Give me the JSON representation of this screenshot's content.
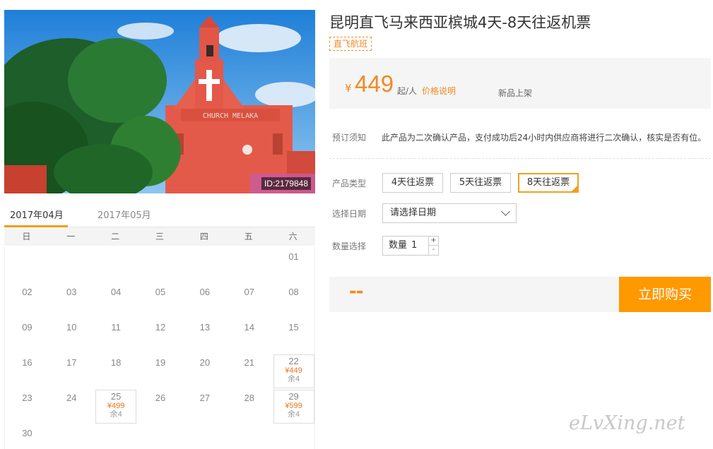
{
  "hero": {
    "id_label": "ID:2179848",
    "sign_text": "CHURCH MELAKA"
  },
  "calendar": {
    "tabs": [
      "2017年04月",
      "2017年05月"
    ],
    "active_tab": 0,
    "weekdays": [
      "日",
      "一",
      "二",
      "三",
      "四",
      "五",
      "六"
    ],
    "days": [
      {
        "day": "01",
        "col": 6,
        "row": 0
      },
      {
        "day": "02",
        "col": 0,
        "row": 1
      },
      {
        "day": "03",
        "col": 1,
        "row": 1
      },
      {
        "day": "04",
        "col": 2,
        "row": 1
      },
      {
        "day": "05",
        "col": 3,
        "row": 1
      },
      {
        "day": "06",
        "col": 4,
        "row": 1
      },
      {
        "day": "07",
        "col": 5,
        "row": 1
      },
      {
        "day": "08",
        "col": 6,
        "row": 1
      },
      {
        "day": "09",
        "col": 0,
        "row": 2
      },
      {
        "day": "10",
        "col": 1,
        "row": 2
      },
      {
        "day": "11",
        "col": 2,
        "row": 2
      },
      {
        "day": "12",
        "col": 3,
        "row": 2
      },
      {
        "day": "13",
        "col": 4,
        "row": 2
      },
      {
        "day": "14",
        "col": 5,
        "row": 2
      },
      {
        "day": "15",
        "col": 6,
        "row": 2
      },
      {
        "day": "16",
        "col": 0,
        "row": 3
      },
      {
        "day": "17",
        "col": 1,
        "row": 3
      },
      {
        "day": "18",
        "col": 2,
        "row": 3
      },
      {
        "day": "19",
        "col": 3,
        "row": 3
      },
      {
        "day": "20",
        "col": 4,
        "row": 3
      },
      {
        "day": "21",
        "col": 5,
        "row": 3
      },
      {
        "day": "22",
        "col": 6,
        "row": 3,
        "price": "¥449",
        "stock": "余4"
      },
      {
        "day": "23",
        "col": 0,
        "row": 4
      },
      {
        "day": "24",
        "col": 1,
        "row": 4
      },
      {
        "day": "25",
        "col": 2,
        "row": 4,
        "price": "¥499",
        "stock": "余4"
      },
      {
        "day": "26",
        "col": 3,
        "row": 4
      },
      {
        "day": "27",
        "col": 4,
        "row": 4
      },
      {
        "day": "28",
        "col": 5,
        "row": 4
      },
      {
        "day": "29",
        "col": 6,
        "row": 4,
        "price": "¥599",
        "stock": "余4"
      },
      {
        "day": "30",
        "col": 0,
        "row": 5
      }
    ]
  },
  "product": {
    "title": "昆明直飞马来西亚槟城4天-8天往返机票",
    "badge": "直飞航班",
    "price_currency": "¥",
    "price_value": "449",
    "price_unit": "起/人",
    "price_note": "价格说明",
    "new_label": "新品上架"
  },
  "booking": {
    "notice_label": "预订须知",
    "notice_text": "此产品为二次确认产品，支付成功后24小时内供应商将进行二次确认，核实是否有位。",
    "type_label": "产品类型",
    "types": [
      "4天往返票",
      "5天往返票",
      "8天往返票"
    ],
    "selected_type": 2,
    "date_label": "选择日期",
    "date_value": "请选择日期",
    "qty_label": "数量选择",
    "qty_prefix": "数量",
    "qty_value": "1",
    "qty_plus": "+",
    "qty_minus": "-",
    "total": "--",
    "buy_label": "立即购买"
  },
  "watermark": "eLvXing.net",
  "colors": {
    "accent": "#f08a24",
    "buy_button": "#ff9900",
    "selected_border": "#f0a020"
  }
}
